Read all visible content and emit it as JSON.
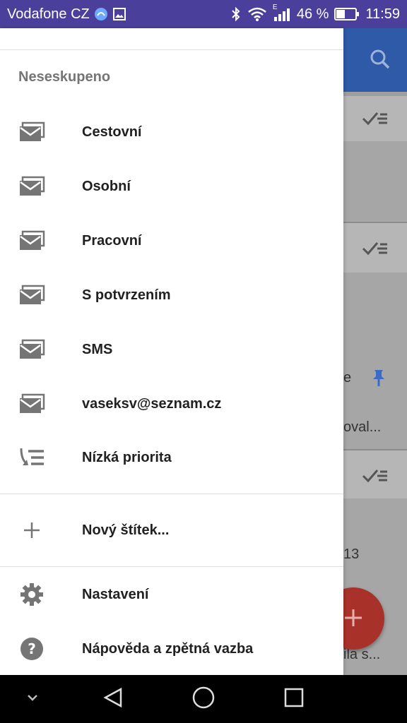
{
  "status_bar": {
    "carrier": "Vodafone CZ",
    "battery": "46 %",
    "time": "11:59",
    "network_type": "E"
  },
  "background": {
    "preview_text_1": "e",
    "preview_text_2": "oval...",
    "preview_text_3": "13",
    "preview_text_4": "ila s..."
  },
  "drawer": {
    "section_title": "Neseskupeno",
    "items": [
      {
        "label": "Cestovní",
        "icon": "inbox-icon"
      },
      {
        "label": "Osobní",
        "icon": "inbox-icon"
      },
      {
        "label": "Pracovní",
        "icon": "inbox-icon"
      },
      {
        "label": "S potvrzením",
        "icon": "inbox-icon"
      },
      {
        "label": "SMS",
        "icon": "inbox-icon"
      },
      {
        "label": "vaseksv@seznam.cz",
        "icon": "inbox-icon"
      },
      {
        "label": "Nízká priorita",
        "icon": "low-priority-icon"
      }
    ],
    "new_label": "Nový štítek...",
    "settings": "Nastavení",
    "help": "Nápověda a zpětná vazba"
  }
}
